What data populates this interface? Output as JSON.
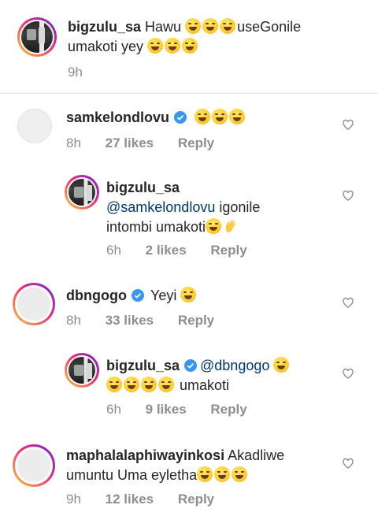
{
  "comments": [
    {
      "username": "bigzulu_sa",
      "verified": false,
      "text_before": "Hawu ",
      "text_mid": "useGonile",
      "text_line2": "umakoti yey ",
      "time": "9h",
      "likes": "",
      "reply": "",
      "avatar": "profile-photo",
      "reply_to": null
    },
    {
      "username": "samkelondlovu",
      "verified": true,
      "text": "",
      "time": "8h",
      "likes": "27 likes",
      "reply": "Reply",
      "avatar": "blank"
    },
    {
      "username": "bigzulu_sa",
      "verified": false,
      "mention": "@samkelondlovu",
      "text_after": " igonile",
      "text_line2": "intombi umakoti",
      "time": "6h",
      "likes": "2 likes",
      "reply": "Reply",
      "avatar": "profile-photo"
    },
    {
      "username": "dbngogo",
      "verified": true,
      "text": "Yeyi ",
      "time": "8h",
      "likes": "33 likes",
      "reply": "Reply",
      "avatar": "story-ring"
    },
    {
      "username": "bigzulu_sa",
      "verified": true,
      "mention": "@dbngogo",
      "text_line2": " umakoti",
      "time": "6h",
      "likes": "9 likes",
      "reply": "Reply",
      "avatar": "profile-photo"
    },
    {
      "username": "maphalalaphiwayinkosi",
      "verified": false,
      "text": " Akadliwe",
      "text_line2": "umuntu Uma eyletha",
      "time": "9h",
      "likes": "12 likes",
      "reply": "Reply",
      "avatar": "story-ring"
    }
  ],
  "colors": {
    "text": "#262626",
    "meta": "#8e8e8e",
    "mention": "#00376b",
    "verified": "#3897f0",
    "ring_start": "#f9ce34",
    "ring_mid": "#ee2a7b",
    "ring_end": "#6228d7"
  },
  "icons": {
    "like": "heart-outline-icon",
    "verified": "verified-badge-icon",
    "laugh": "face-with-tears-of-joy-emoji",
    "rofl": "rolling-on-floor-laughing-emoji",
    "clap": "waving-hand-emoji"
  }
}
